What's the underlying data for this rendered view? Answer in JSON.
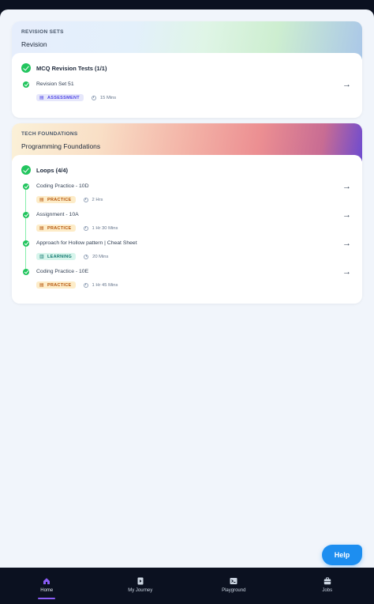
{
  "sections": [
    {
      "tag": "REVISION SETS",
      "title": "Revision",
      "module": {
        "title": "MCQ Revision Tests (1/1)",
        "items": [
          {
            "title": "Revision Set 51",
            "badge": "ASSESSMENT",
            "badge_type": "assessment",
            "duration": "15 Mins"
          }
        ]
      }
    },
    {
      "tag": "TECH FOUNDATIONS",
      "title": "Programming Foundations",
      "module": {
        "title": "Loops (4/4)",
        "items": [
          {
            "title": "Coding Practice - 10D",
            "badge": "PRACTICE",
            "badge_type": "practice",
            "duration": "2 Hrs"
          },
          {
            "title": "Assignment - 10A",
            "badge": "PRACTICE",
            "badge_type": "practice",
            "duration": "1 Hr 30 Mins"
          },
          {
            "title": "Approach for Hollow pattern | Cheat Sheet",
            "badge": "LEARNING",
            "badge_type": "learning",
            "duration": "20 Mins"
          },
          {
            "title": "Coding Practice - 10E",
            "badge": "PRACTICE",
            "badge_type": "practice",
            "duration": "1 Hr 45 Mins"
          }
        ]
      }
    }
  ],
  "help": {
    "label": "Help"
  },
  "nav": {
    "items": [
      {
        "label": "Home",
        "icon": "home-icon",
        "active": true
      },
      {
        "label": "My Journey",
        "icon": "journey-icon",
        "active": false
      },
      {
        "label": "Playground",
        "icon": "terminal-icon",
        "active": false
      },
      {
        "label": "Jobs",
        "icon": "briefcase-icon",
        "active": false
      }
    ]
  },
  "colors": {
    "accent": "#8b5cf6",
    "success": "#22c55e",
    "help": "#1d8ef0",
    "nav_bg": "#0b1120"
  }
}
